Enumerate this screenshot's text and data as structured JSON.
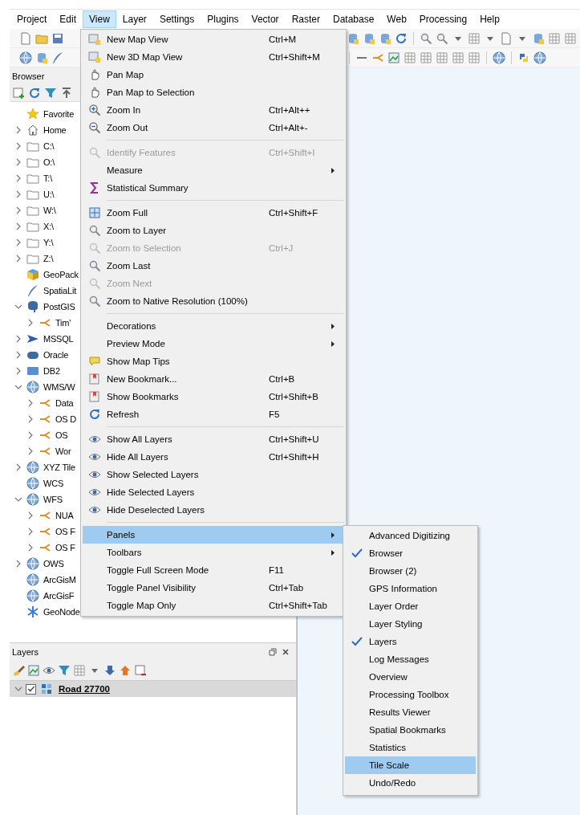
{
  "menubar": [
    {
      "label": "Project",
      "selected": false
    },
    {
      "label": "Edit",
      "selected": false
    },
    {
      "label": "View",
      "selected": true
    },
    {
      "label": "Layer",
      "selected": false
    },
    {
      "label": "Settings",
      "selected": false
    },
    {
      "label": "Plugins",
      "selected": false
    },
    {
      "label": "Vector",
      "selected": false
    },
    {
      "label": "Raster",
      "selected": false
    },
    {
      "label": "Database",
      "selected": false
    },
    {
      "label": "Web",
      "selected": false
    },
    {
      "label": "Processing",
      "selected": false
    },
    {
      "label": "Help",
      "selected": false
    }
  ],
  "browser": {
    "title": "Browser",
    "items": [
      {
        "label": "Favorite",
        "kind": "favorites"
      },
      {
        "label": "Home",
        "kind": "home",
        "expanded": false
      },
      {
        "label": "C:\\",
        "kind": "folder",
        "expanded": false
      },
      {
        "label": "O:\\",
        "kind": "folder",
        "expanded": false
      },
      {
        "label": "T:\\",
        "kind": "folder",
        "expanded": false
      },
      {
        "label": "U:\\",
        "kind": "folder",
        "expanded": false
      },
      {
        "label": "W:\\",
        "kind": "folder",
        "expanded": false
      },
      {
        "label": "X:\\",
        "kind": "folder",
        "expanded": false
      },
      {
        "label": "Y:\\",
        "kind": "folder",
        "expanded": false
      },
      {
        "label": "Z:\\",
        "kind": "folder",
        "expanded": false
      },
      {
        "label": "GeoPack",
        "kind": "geopackage"
      },
      {
        "label": "SpatiaLit",
        "kind": "spatialite"
      },
      {
        "label": "PostGIS",
        "kind": "postgis",
        "expanded": true,
        "children": [
          {
            "label": "Tim'",
            "kind": "connection",
            "expanded": false
          }
        ]
      },
      {
        "label": "MSSQL",
        "kind": "mssql",
        "expanded": false
      },
      {
        "label": "Oracle",
        "kind": "oracle",
        "expanded": false
      },
      {
        "label": "DB2",
        "kind": "db2",
        "expanded": false
      },
      {
        "label": "WMS/W",
        "kind": "wms",
        "expanded": true,
        "children": [
          {
            "label": "Data",
            "kind": "connection",
            "expanded": false
          },
          {
            "label": "OS D",
            "kind": "connection",
            "expanded": false
          },
          {
            "label": "OS",
            "kind": "connection",
            "expanded": false
          },
          {
            "label": "Wor",
            "kind": "connection",
            "expanded": false
          }
        ]
      },
      {
        "label": "XYZ Tile",
        "kind": "wms",
        "expanded": false
      },
      {
        "label": "WCS",
        "kind": "wcs"
      },
      {
        "label": "WFS",
        "kind": "wms",
        "expanded": true,
        "children": [
          {
            "label": "NUA",
            "kind": "connection",
            "expanded": false
          },
          {
            "label": "OS F",
            "kind": "connection",
            "expanded": false
          },
          {
            "label": "OS F",
            "kind": "connection",
            "expanded": false
          }
        ]
      },
      {
        "label": "OWS",
        "kind": "wms",
        "expanded": false
      },
      {
        "label": "ArcGisM",
        "kind": "arcgis"
      },
      {
        "label": "ArcGisF",
        "kind": "arcgis"
      },
      {
        "label": "GeoNode",
        "kind": "geonode"
      }
    ]
  },
  "layers": {
    "title": "Layers",
    "items": [
      {
        "label": "Road 27700",
        "checked": true,
        "selected": true,
        "expanded": true
      }
    ]
  },
  "view_menu": {
    "items": [
      {
        "kind": "item",
        "label": "New Map View",
        "shortcut": "Ctrl+M",
        "selected": false
      },
      {
        "kind": "item",
        "label": "New 3D Map View",
        "shortcut": "Ctrl+Shift+M",
        "selected": false
      },
      {
        "kind": "item",
        "label": "Pan Map",
        "selected": false
      },
      {
        "kind": "item",
        "label": "Pan Map to Selection",
        "selected": false
      },
      {
        "kind": "item",
        "label": "Zoom In",
        "shortcut": "Ctrl+Alt++",
        "selected": false
      },
      {
        "kind": "item",
        "label": "Zoom Out",
        "shortcut": "Ctrl+Alt+-",
        "selected": false
      },
      {
        "kind": "separator"
      },
      {
        "kind": "item",
        "label": "Identify Features",
        "shortcut": "Ctrl+Shift+I",
        "selected": false,
        "disabled": true
      },
      {
        "kind": "item",
        "label": "Measure",
        "selected": false,
        "submenu": true
      },
      {
        "kind": "item",
        "label": "Statistical Summary",
        "selected": false
      },
      {
        "kind": "separator"
      },
      {
        "kind": "item",
        "label": "Zoom Full",
        "shortcut": "Ctrl+Shift+F",
        "selected": false
      },
      {
        "kind": "item",
        "label": "Zoom to Layer",
        "selected": false
      },
      {
        "kind": "item",
        "label": "Zoom to Selection",
        "shortcut": "Ctrl+J",
        "selected": false,
        "disabled": true
      },
      {
        "kind": "item",
        "label": "Zoom Last",
        "selected": false
      },
      {
        "kind": "item",
        "label": "Zoom Next",
        "selected": false,
        "disabled": true
      },
      {
        "kind": "item",
        "label": "Zoom to Native Resolution (100%)",
        "selected": false
      },
      {
        "kind": "separator"
      },
      {
        "kind": "item",
        "label": "Decorations",
        "selected": false,
        "submenu": true
      },
      {
        "kind": "item",
        "label": "Preview Mode",
        "selected": false,
        "submenu": true
      },
      {
        "kind": "item",
        "label": "Show Map Tips",
        "selected": false
      },
      {
        "kind": "item",
        "label": "New Bookmark...",
        "shortcut": "Ctrl+B",
        "selected": false
      },
      {
        "kind": "item",
        "label": "Show Bookmarks",
        "shortcut": "Ctrl+Shift+B",
        "selected": false
      },
      {
        "kind": "item",
        "label": "Refresh",
        "shortcut": "F5",
        "selected": false
      },
      {
        "kind": "separator"
      },
      {
        "kind": "item",
        "label": "Show All Layers",
        "shortcut": "Ctrl+Shift+U",
        "selected": false
      },
      {
        "kind": "item",
        "label": "Hide All Layers",
        "shortcut": "Ctrl+Shift+H",
        "selected": false
      },
      {
        "kind": "item",
        "label": "Show Selected Layers",
        "selected": false
      },
      {
        "kind": "item",
        "label": "Hide Selected Layers",
        "selected": false
      },
      {
        "kind": "item",
        "label": "Hide Deselected Layers",
        "selected": false
      },
      {
        "kind": "separator"
      },
      {
        "kind": "item",
        "label": "Panels",
        "selected": true,
        "submenu": true
      },
      {
        "kind": "item",
        "label": "Toolbars",
        "selected": false,
        "submenu": true
      },
      {
        "kind": "item",
        "label": "Toggle Full Screen Mode",
        "shortcut": "F11",
        "selected": false
      },
      {
        "kind": "item",
        "label": "Toggle Panel Visibility",
        "shortcut": "Ctrl+Tab",
        "selected": false
      },
      {
        "kind": "item",
        "label": "Toggle Map Only",
        "shortcut": "Ctrl+Shift+Tab",
        "selected": false
      }
    ]
  },
  "panels_submenu": {
    "items": [
      {
        "label": "Advanced Digitizing",
        "checked": false,
        "selected": false
      },
      {
        "label": "Browser",
        "checked": true,
        "selected": false
      },
      {
        "label": "Browser (2)",
        "checked": false,
        "selected": false
      },
      {
        "label": "GPS Information",
        "checked": false,
        "selected": false
      },
      {
        "label": "Layer Order",
        "checked": false,
        "selected": false
      },
      {
        "label": "Layer Styling",
        "checked": false,
        "selected": false
      },
      {
        "label": "Layers",
        "checked": true,
        "selected": false
      },
      {
        "label": "Log Messages",
        "checked": false,
        "selected": false
      },
      {
        "label": "Overview",
        "checked": false,
        "selected": false
      },
      {
        "label": "Processing Toolbox",
        "checked": false,
        "selected": false
      },
      {
        "label": "Results Viewer",
        "checked": false,
        "selected": false
      },
      {
        "label": "Spatial Bookmarks",
        "checked": false,
        "selected": false
      },
      {
        "label": "Statistics",
        "checked": false,
        "selected": false
      },
      {
        "label": "Tile Scale",
        "checked": false,
        "selected": true
      },
      {
        "label": "Undo/Redo",
        "checked": false,
        "selected": false
      }
    ]
  }
}
